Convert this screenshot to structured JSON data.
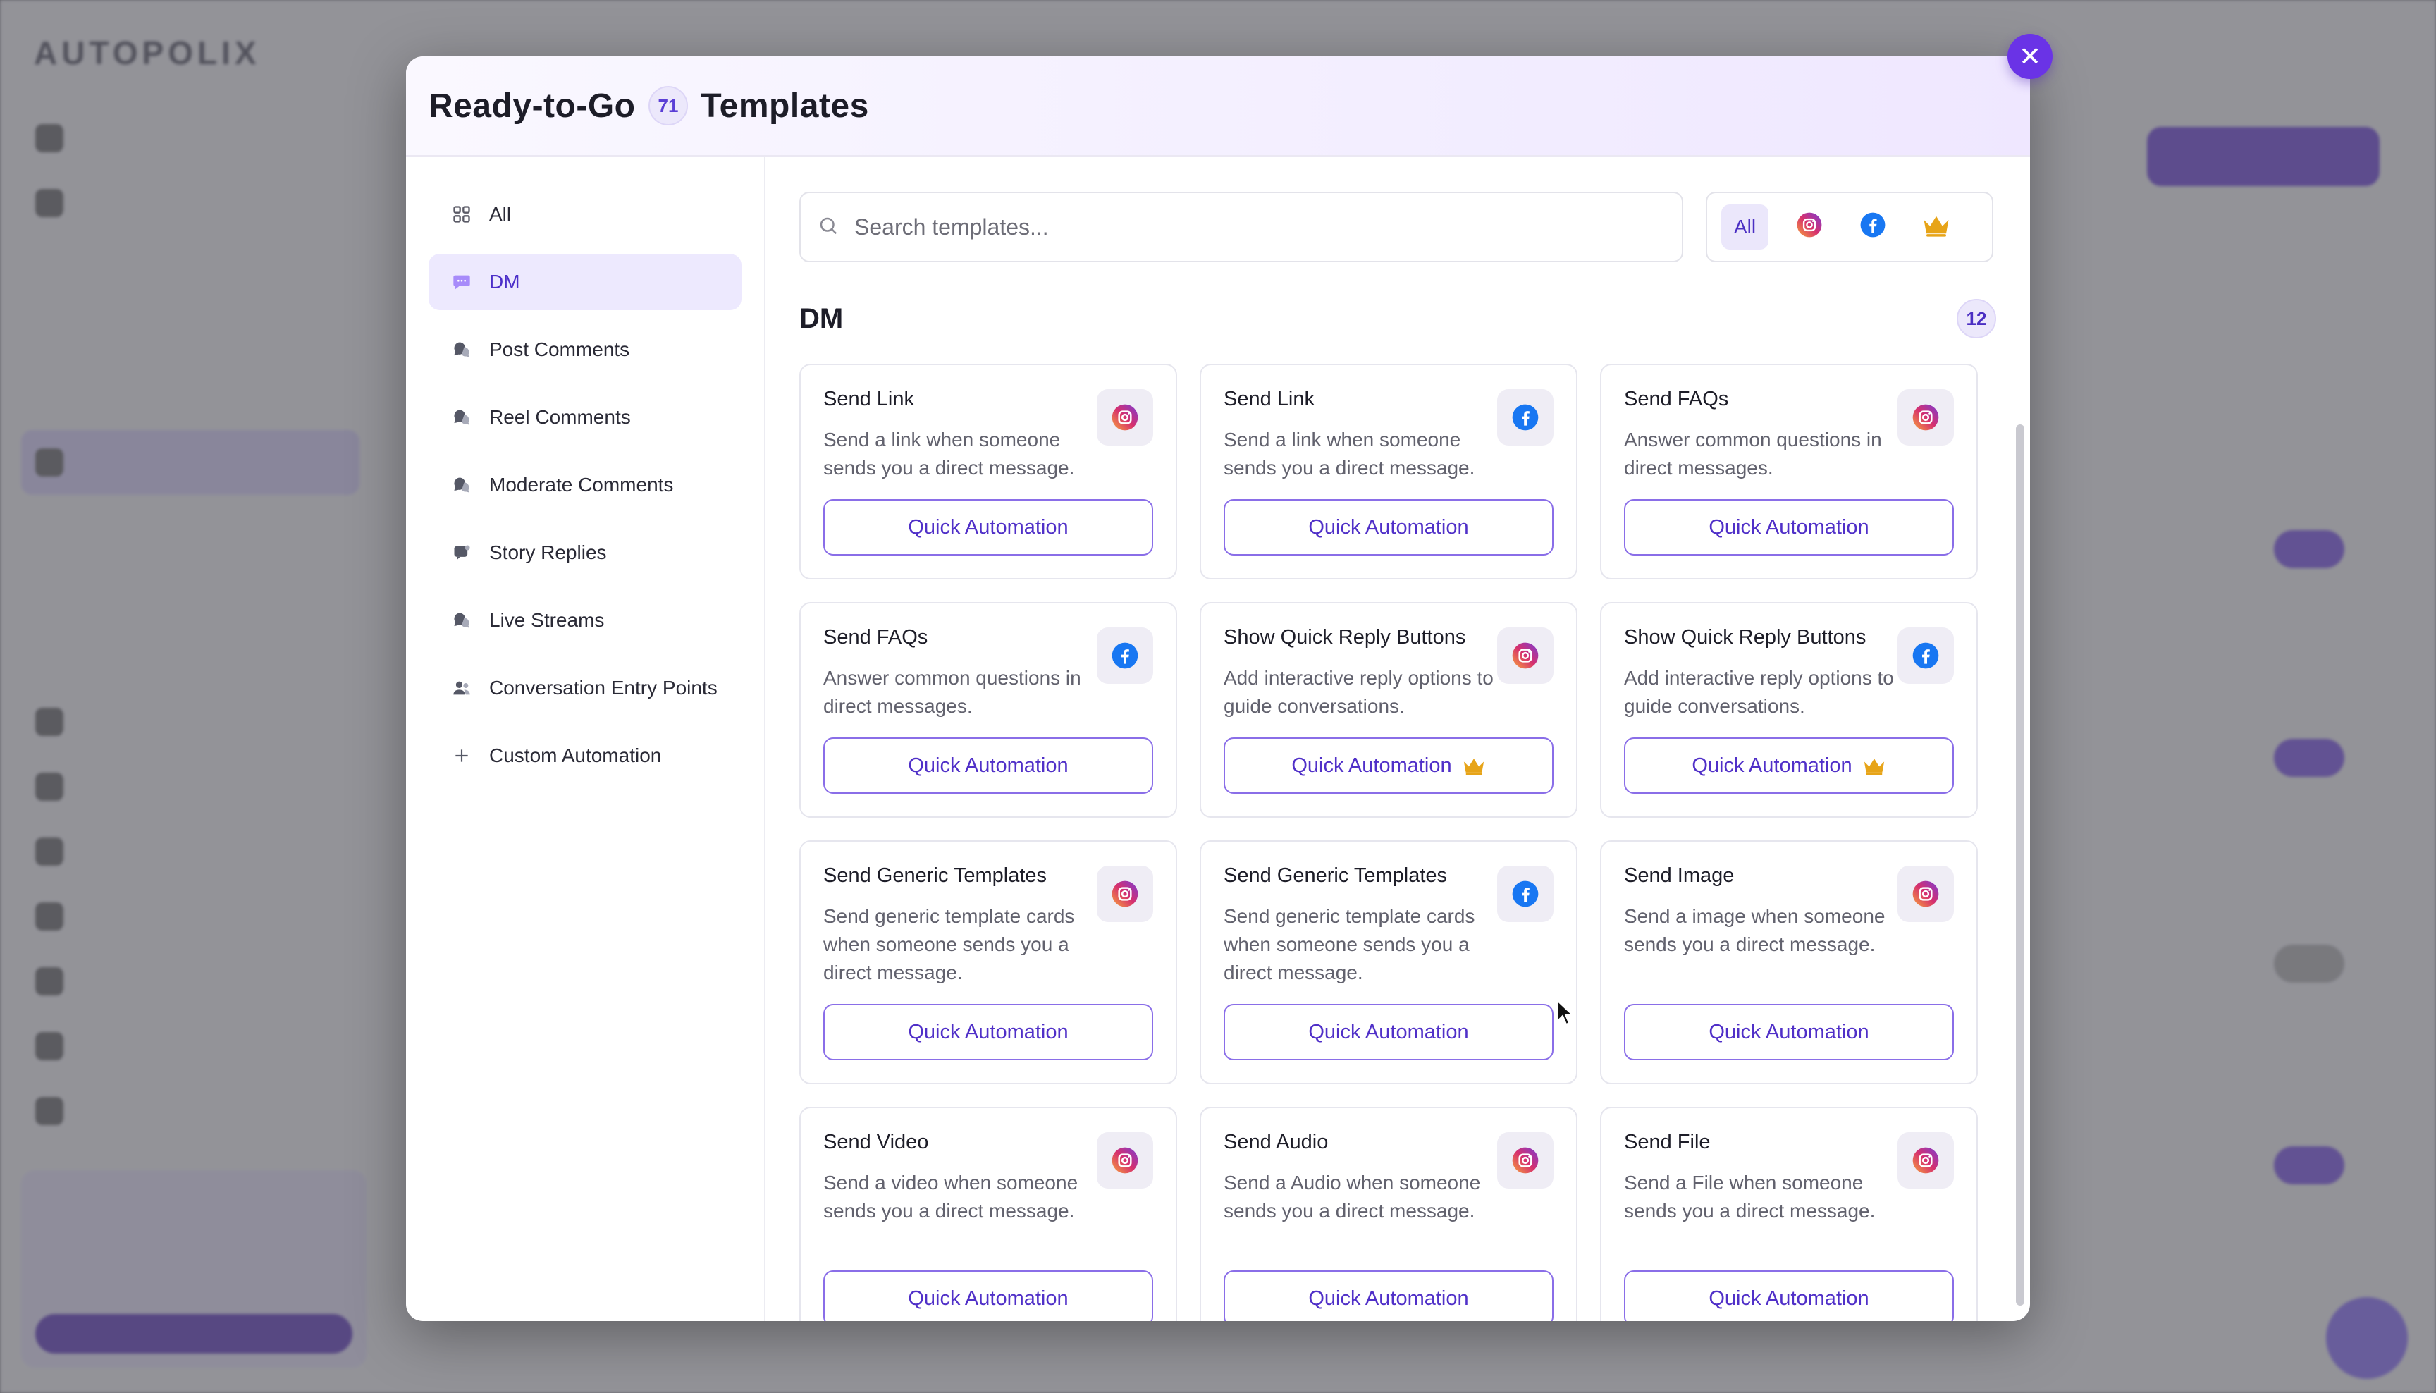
{
  "background": {
    "logo": "AUTOPOLIX"
  },
  "modal": {
    "title_prefix": "Ready-to-Go",
    "template_count": "71",
    "title_suffix": "Templates",
    "close_icon": "close-icon"
  },
  "sidebar": {
    "items": [
      {
        "label": "All",
        "icon": "grid-icon",
        "active": false
      },
      {
        "label": "DM",
        "icon": "message-icon",
        "active": true
      },
      {
        "label": "Post Comments",
        "icon": "comment-icon",
        "active": false
      },
      {
        "label": "Reel Comments",
        "icon": "comment-icon",
        "active": false
      },
      {
        "label": "Moderate Comments",
        "icon": "comment-icon",
        "active": false
      },
      {
        "label": "Story Replies",
        "icon": "story-icon",
        "active": false
      },
      {
        "label": "Live Streams",
        "icon": "comment-icon",
        "active": false
      },
      {
        "label": "Conversation Entry Points",
        "icon": "users-icon",
        "active": false
      },
      {
        "label": "Custom Automation",
        "icon": "plus-icon",
        "active": false
      }
    ]
  },
  "search": {
    "placeholder": "Search templates...",
    "value": ""
  },
  "filters": {
    "all_label": "All",
    "items": [
      "instagram-icon",
      "facebook-icon",
      "crown-icon"
    ]
  },
  "section": {
    "title": "DM",
    "count": "12"
  },
  "cards": [
    {
      "title": "Send Link",
      "desc": "Send a link when someone sends you a direct message.",
      "platform": "instagram",
      "button": "Quick Automation",
      "premium": false
    },
    {
      "title": "Send Link",
      "desc": "Send a link when someone sends you a direct message.",
      "platform": "facebook",
      "button": "Quick Automation",
      "premium": false
    },
    {
      "title": "Send FAQs",
      "desc": "Answer common questions in direct messages.",
      "platform": "instagram",
      "button": "Quick Automation",
      "premium": false
    },
    {
      "title": "Send FAQs",
      "desc": "Answer common questions in direct messages.",
      "platform": "facebook",
      "button": "Quick Automation",
      "premium": false
    },
    {
      "title": "Show Quick Reply Buttons",
      "desc": "Add interactive reply options to guide conversations.",
      "platform": "instagram",
      "button": "Quick Automation",
      "premium": true
    },
    {
      "title": "Show Quick Reply Buttons",
      "desc": "Add interactive reply options to guide conversations.",
      "platform": "facebook",
      "button": "Quick Automation",
      "premium": true
    },
    {
      "title": "Send Generic Templates",
      "desc": "Send generic template cards when someone sends you a direct message.",
      "platform": "instagram",
      "button": "Quick Automation",
      "premium": false
    },
    {
      "title": "Send Generic Templates",
      "desc": "Send generic template cards when someone sends you a direct message.",
      "platform": "facebook",
      "button": "Quick Automation",
      "premium": false
    },
    {
      "title": "Send Image",
      "desc": "Send a image when someone sends you a direct message.",
      "platform": "instagram",
      "button": "Quick Automation",
      "premium": false
    },
    {
      "title": "Send Video",
      "desc": "Send a video when someone sends you a direct message.",
      "platform": "instagram",
      "button": "Quick Automation",
      "premium": false
    },
    {
      "title": "Send Audio",
      "desc": "Send a Audio when someone sends you a direct message.",
      "platform": "instagram",
      "button": "Quick Automation",
      "premium": false
    },
    {
      "title": "Send File",
      "desc": "Send a File when someone sends you a direct message.",
      "platform": "instagram",
      "button": "Quick Automation",
      "premium": false
    }
  ],
  "colors": {
    "accent": "#6a33e6",
    "instagram": "#d6306e",
    "facebook": "#1877f2",
    "crown": "#e7a418"
  }
}
